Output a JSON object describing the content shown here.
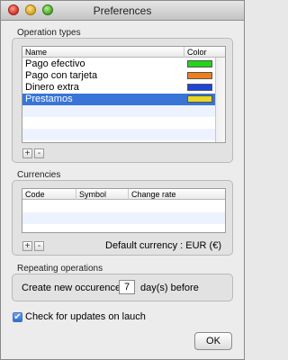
{
  "window": {
    "title": "Preferences"
  },
  "operation_types": {
    "section_label": "Operation types",
    "columns": [
      "Name",
      "Color"
    ],
    "rows": [
      {
        "name": "Pago efectivo",
        "color": "#21d51a",
        "selected": false
      },
      {
        "name": "Pago con tarjeta",
        "color": "#f07d1c",
        "selected": false
      },
      {
        "name": "Dinero extra",
        "color": "#1d45d6",
        "selected": false
      },
      {
        "name": "Prestamos",
        "color": "#e7d625",
        "selected": true
      }
    ],
    "add_label": "+",
    "remove_label": "-"
  },
  "currencies": {
    "section_label": "Currencies",
    "columns": [
      "Code",
      "Symbol",
      "Change rate"
    ],
    "add_label": "+",
    "remove_label": "-",
    "default_currency": "Default currency : EUR (€)"
  },
  "repeating": {
    "section_label": "Repeating operations",
    "prefix": "Create new occurences",
    "days_value": "7",
    "suffix": "day(s) before"
  },
  "check_updates": {
    "label": "Check for updates on lauch",
    "checked": true
  },
  "ok_button": {
    "label": "OK"
  }
}
